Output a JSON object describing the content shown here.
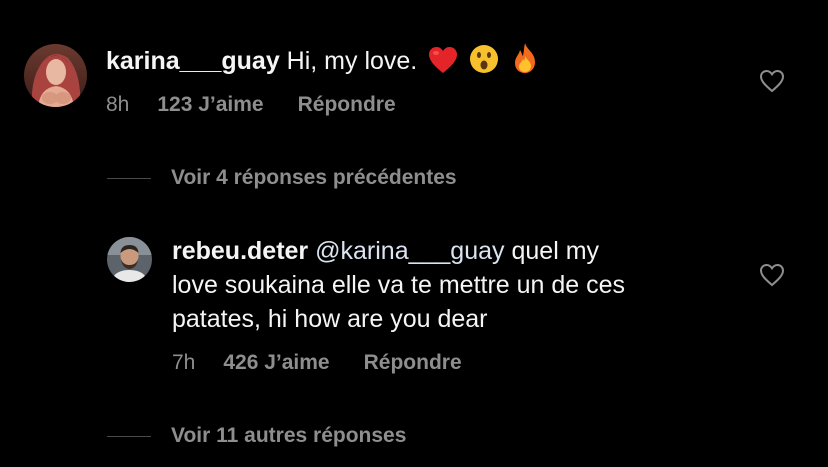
{
  "comments": [
    {
      "username": "karina___guay",
      "text": "Hi, my love.",
      "emojis": [
        "red-heart-emoji",
        "surprised-face-emoji",
        "fire-emoji"
      ],
      "time": "8h",
      "likes": "123 J’aime",
      "reply": "Répondre"
    },
    {
      "username": "rebeu.deter",
      "mention": "@karina___guay",
      "text_line1": " quel my",
      "text_line2": "love soukaina elle va te mettre un de ces",
      "text_line3": "patates, hi how are you dear",
      "time": "7h",
      "likes": "426 J’aime",
      "reply": "Répondre"
    }
  ],
  "threads": {
    "previous": "Voir 4 réponses précédentes",
    "more": "Voir 11 autres réponses"
  },
  "colors": {
    "background": "#000000",
    "text": "#f5f5f5",
    "secondary": "#8e8e8e",
    "heart_outline": "#8e8e8e"
  },
  "icons": {
    "like": "heart-outline-icon"
  }
}
